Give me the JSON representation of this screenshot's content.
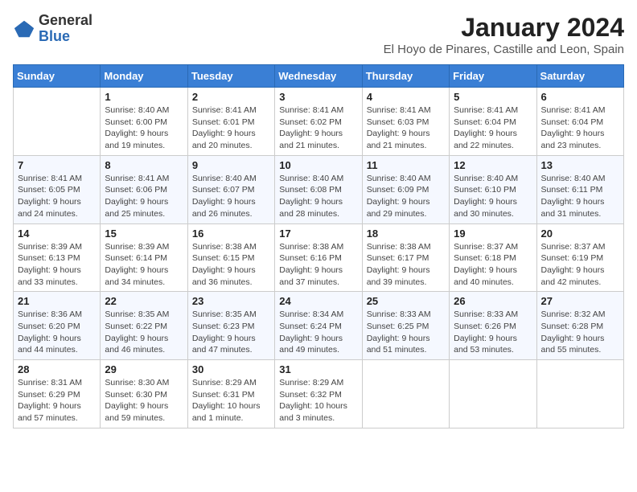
{
  "logo": {
    "general": "General",
    "blue": "Blue"
  },
  "title": "January 2024",
  "location": "El Hoyo de Pinares, Castille and Leon, Spain",
  "weekdays": [
    "Sunday",
    "Monday",
    "Tuesday",
    "Wednesday",
    "Thursday",
    "Friday",
    "Saturday"
  ],
  "weeks": [
    [
      {
        "day": "",
        "info": ""
      },
      {
        "day": "1",
        "info": "Sunrise: 8:40 AM\nSunset: 6:00 PM\nDaylight: 9 hours\nand 19 minutes."
      },
      {
        "day": "2",
        "info": "Sunrise: 8:41 AM\nSunset: 6:01 PM\nDaylight: 9 hours\nand 20 minutes."
      },
      {
        "day": "3",
        "info": "Sunrise: 8:41 AM\nSunset: 6:02 PM\nDaylight: 9 hours\nand 21 minutes."
      },
      {
        "day": "4",
        "info": "Sunrise: 8:41 AM\nSunset: 6:03 PM\nDaylight: 9 hours\nand 21 minutes."
      },
      {
        "day": "5",
        "info": "Sunrise: 8:41 AM\nSunset: 6:04 PM\nDaylight: 9 hours\nand 22 minutes."
      },
      {
        "day": "6",
        "info": "Sunrise: 8:41 AM\nSunset: 6:04 PM\nDaylight: 9 hours\nand 23 minutes."
      }
    ],
    [
      {
        "day": "7",
        "info": "Sunrise: 8:41 AM\nSunset: 6:05 PM\nDaylight: 9 hours\nand 24 minutes."
      },
      {
        "day": "8",
        "info": "Sunrise: 8:41 AM\nSunset: 6:06 PM\nDaylight: 9 hours\nand 25 minutes."
      },
      {
        "day": "9",
        "info": "Sunrise: 8:40 AM\nSunset: 6:07 PM\nDaylight: 9 hours\nand 26 minutes."
      },
      {
        "day": "10",
        "info": "Sunrise: 8:40 AM\nSunset: 6:08 PM\nDaylight: 9 hours\nand 28 minutes."
      },
      {
        "day": "11",
        "info": "Sunrise: 8:40 AM\nSunset: 6:09 PM\nDaylight: 9 hours\nand 29 minutes."
      },
      {
        "day": "12",
        "info": "Sunrise: 8:40 AM\nSunset: 6:10 PM\nDaylight: 9 hours\nand 30 minutes."
      },
      {
        "day": "13",
        "info": "Sunrise: 8:40 AM\nSunset: 6:11 PM\nDaylight: 9 hours\nand 31 minutes."
      }
    ],
    [
      {
        "day": "14",
        "info": "Sunrise: 8:39 AM\nSunset: 6:13 PM\nDaylight: 9 hours\nand 33 minutes."
      },
      {
        "day": "15",
        "info": "Sunrise: 8:39 AM\nSunset: 6:14 PM\nDaylight: 9 hours\nand 34 minutes."
      },
      {
        "day": "16",
        "info": "Sunrise: 8:38 AM\nSunset: 6:15 PM\nDaylight: 9 hours\nand 36 minutes."
      },
      {
        "day": "17",
        "info": "Sunrise: 8:38 AM\nSunset: 6:16 PM\nDaylight: 9 hours\nand 37 minutes."
      },
      {
        "day": "18",
        "info": "Sunrise: 8:38 AM\nSunset: 6:17 PM\nDaylight: 9 hours\nand 39 minutes."
      },
      {
        "day": "19",
        "info": "Sunrise: 8:37 AM\nSunset: 6:18 PM\nDaylight: 9 hours\nand 40 minutes."
      },
      {
        "day": "20",
        "info": "Sunrise: 8:37 AM\nSunset: 6:19 PM\nDaylight: 9 hours\nand 42 minutes."
      }
    ],
    [
      {
        "day": "21",
        "info": "Sunrise: 8:36 AM\nSunset: 6:20 PM\nDaylight: 9 hours\nand 44 minutes."
      },
      {
        "day": "22",
        "info": "Sunrise: 8:35 AM\nSunset: 6:22 PM\nDaylight: 9 hours\nand 46 minutes."
      },
      {
        "day": "23",
        "info": "Sunrise: 8:35 AM\nSunset: 6:23 PM\nDaylight: 9 hours\nand 47 minutes."
      },
      {
        "day": "24",
        "info": "Sunrise: 8:34 AM\nSunset: 6:24 PM\nDaylight: 9 hours\nand 49 minutes."
      },
      {
        "day": "25",
        "info": "Sunrise: 8:33 AM\nSunset: 6:25 PM\nDaylight: 9 hours\nand 51 minutes."
      },
      {
        "day": "26",
        "info": "Sunrise: 8:33 AM\nSunset: 6:26 PM\nDaylight: 9 hours\nand 53 minutes."
      },
      {
        "day": "27",
        "info": "Sunrise: 8:32 AM\nSunset: 6:28 PM\nDaylight: 9 hours\nand 55 minutes."
      }
    ],
    [
      {
        "day": "28",
        "info": "Sunrise: 8:31 AM\nSunset: 6:29 PM\nDaylight: 9 hours\nand 57 minutes."
      },
      {
        "day": "29",
        "info": "Sunrise: 8:30 AM\nSunset: 6:30 PM\nDaylight: 9 hours\nand 59 minutes."
      },
      {
        "day": "30",
        "info": "Sunrise: 8:29 AM\nSunset: 6:31 PM\nDaylight: 10 hours\nand 1 minute."
      },
      {
        "day": "31",
        "info": "Sunrise: 8:29 AM\nSunset: 6:32 PM\nDaylight: 10 hours\nand 3 minutes."
      },
      {
        "day": "",
        "info": ""
      },
      {
        "day": "",
        "info": ""
      },
      {
        "day": "",
        "info": ""
      }
    ]
  ]
}
